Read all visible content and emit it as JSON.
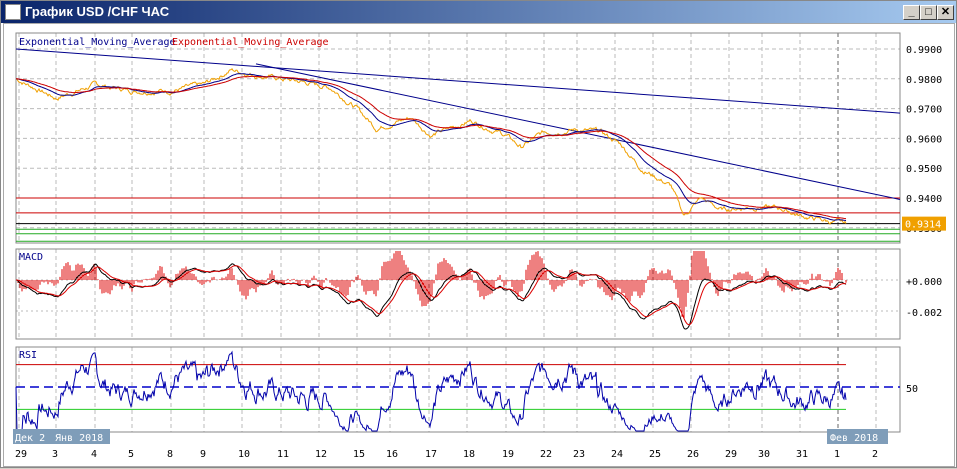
{
  "window": {
    "title": "График USD /CHF ЧАС",
    "minimize": "_",
    "maximize": "□",
    "close": "✕"
  },
  "legend": {
    "ema1": "Exponential_Moving_Average",
    "ema2": "Exponential_Moving_Average",
    "ema1_color": "#00008b",
    "ema2_color": "#cc0000"
  },
  "price_axis": {
    "labels": [
      "0.9900",
      "0.9800",
      "0.9700",
      "0.9600",
      "0.9500",
      "0.9400",
      "0.9300"
    ],
    "values": [
      0.99,
      0.98,
      0.97,
      0.96,
      0.95,
      0.94,
      0.93
    ],
    "current": "0.9314",
    "current_color": "#f0a000"
  },
  "macd": {
    "label": "MACD",
    "axis": [
      "+0.000",
      "-0.002"
    ]
  },
  "rsi": {
    "label": "RSI",
    "axis": [
      "50"
    ],
    "levels": [
      70,
      50,
      30
    ]
  },
  "time_axis": {
    "dates": [
      "29",
      "3",
      "4",
      "5",
      "8",
      "9",
      "10",
      "11",
      "12",
      "15",
      "16",
      "17",
      "18",
      "19",
      "22",
      "23",
      "24",
      "25",
      "26",
      "29",
      "30",
      "31",
      "1",
      "2"
    ],
    "tags": [
      "Дек 2",
      "Янв 2018",
      "Фев 2018"
    ]
  },
  "chart_data": {
    "type": "line",
    "title": "График USD /CHF ЧАС",
    "ylim": [
      0.926,
      0.995
    ],
    "price_keypoints": [
      [
        0,
        0.98
      ],
      [
        40,
        0.9735
      ],
      [
        79,
        0.978
      ],
      [
        116,
        0.976
      ],
      [
        155,
        0.976
      ],
      [
        188,
        0.978
      ],
      [
        215,
        0.983
      ],
      [
        245,
        0.981
      ],
      [
        285,
        0.979
      ],
      [
        315,
        0.977
      ],
      [
        341,
        0.97
      ],
      [
        360,
        0.9635
      ],
      [
        395,
        0.967
      ],
      [
        415,
        0.961
      ],
      [
        455,
        0.966
      ],
      [
        490,
        0.961
      ],
      [
        505,
        0.957
      ],
      [
        528,
        0.962
      ],
      [
        561,
        0.963
      ],
      [
        585,
        0.962
      ],
      [
        605,
        0.958
      ],
      [
        625,
        0.95
      ],
      [
        640,
        0.947
      ],
      [
        655,
        0.944
      ],
      [
        668,
        0.934
      ],
      [
        685,
        0.94
      ],
      [
        705,
        0.936
      ],
      [
        735,
        0.937
      ],
      [
        765,
        0.9365
      ],
      [
        785,
        0.934
      ],
      [
        815,
        0.932
      ],
      [
        830,
        0.9314
      ]
    ],
    "hlines": [
      {
        "v": 0.94,
        "c": "#cc0000"
      },
      {
        "v": 0.935,
        "c": "#cc0000"
      },
      {
        "v": 0.9314,
        "c": "#000000"
      },
      {
        "v": 0.9295,
        "c": "#22aa22"
      },
      {
        "v": 0.928,
        "c": "#22aa22"
      },
      {
        "v": 0.9255,
        "c": "#22aa22"
      }
    ],
    "trendlines": [
      [
        [
          0,
          0.99
        ],
        [
          884,
          0.9685
        ]
      ],
      [
        [
          240,
          0.985
        ],
        [
          884,
          0.9395
        ]
      ]
    ]
  }
}
